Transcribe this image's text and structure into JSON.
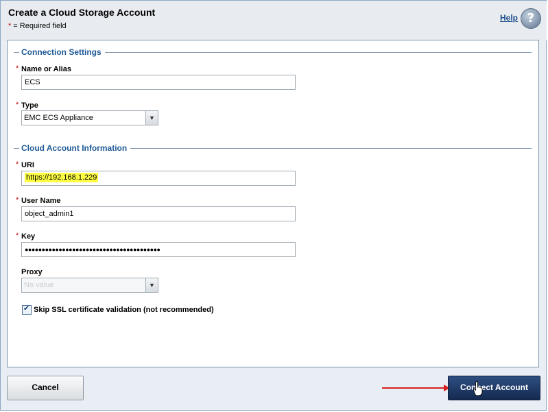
{
  "dialog": {
    "title": "Create a Cloud Storage Account",
    "required_star": "*",
    "required_note": "= Required field",
    "help_label": "Help",
    "help_icon_glyph": "?"
  },
  "connection": {
    "section_title": "Connection Settings",
    "name_label": "Name or Alias",
    "name_value": "ECS",
    "type_label": "Type",
    "type_value": "EMC ECS Appliance"
  },
  "account": {
    "section_title": "Cloud Account Information",
    "uri_label": "URI",
    "uri_value": "https://192.168.1.229",
    "username_label": "User Name",
    "username_value": "object_admin1",
    "key_label": "Key",
    "key_value": "●●●●●●●●●●●●●●●●●●●●●●●●●●●●●●●●●●●●●●●●",
    "proxy_label": "Proxy",
    "proxy_value": "No value",
    "skip_ssl_label": "Skip SSL certificate validation (not recommended)",
    "skip_ssl_checked": true
  },
  "buttons": {
    "cancel": "Cancel",
    "connect": "Connect Account"
  },
  "colors": {
    "section_title": "#1f5a96",
    "required_star": "#c00000",
    "uri_highlight": "#ffff44",
    "connect_button": "#1b3563",
    "annotation_arrow": "#d62020"
  }
}
